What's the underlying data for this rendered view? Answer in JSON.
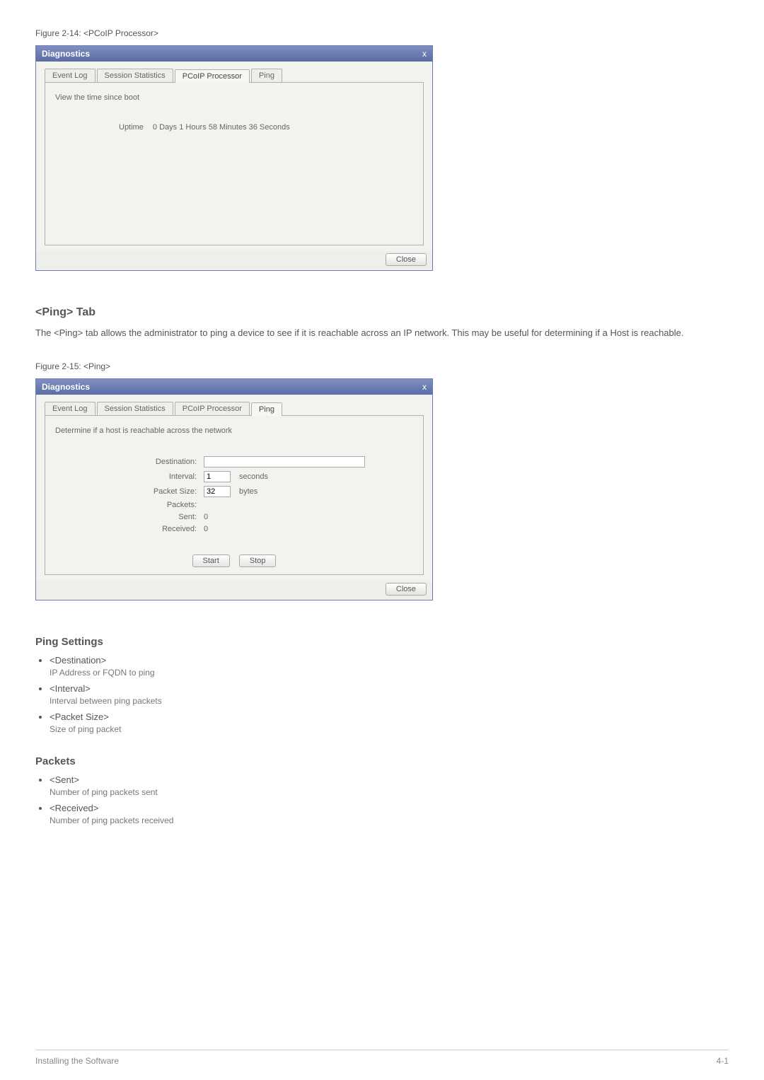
{
  "figure1": {
    "caption": "Figure 2-14: <PCoIP Processor>"
  },
  "dialog1": {
    "title": "Diagnostics",
    "close_label": "x",
    "tabs": {
      "event_log": "Event Log",
      "session_stats": "Session Statistics",
      "pcoip": "PCoIP Processor",
      "ping": "Ping"
    },
    "hint": "View the time since boot",
    "uptime_label": "Uptime",
    "uptime_value": "0 Days 1 Hours 58 Minutes 36 Seconds",
    "close_btn": "Close"
  },
  "ping_section": {
    "heading": "<Ping> Tab",
    "body": "The <Ping> tab allows the administrator to ping a device to see if it is reachable across an IP network. This may be useful for determining if a Host is reachable."
  },
  "figure2": {
    "caption": "Figure 2-15: <Ping>"
  },
  "dialog2": {
    "title": "Diagnostics",
    "close_label": "x",
    "tabs": {
      "event_log": "Event Log",
      "session_stats": "Session Statistics",
      "pcoip": "PCoIP Processor",
      "ping": "Ping"
    },
    "hint": "Determine if a host is reachable across the network",
    "rows": {
      "destination_label": "Destination:",
      "destination_value": "",
      "interval_label": "Interval:",
      "interval_value": "1",
      "interval_suffix": "seconds",
      "packetsize_label": "Packet Size:",
      "packetsize_value": "32",
      "packetsize_suffix": "bytes",
      "packets_label": "Packets:",
      "sent_label": "Sent:",
      "sent_value": "0",
      "received_label": "Received:",
      "received_value": "0"
    },
    "start_btn": "Start",
    "stop_btn": "Stop",
    "close_btn": "Close"
  },
  "ping_settings": {
    "heading": "Ping Settings",
    "items": [
      {
        "term": "<Destination>",
        "desc": "IP Address or FQDN to ping"
      },
      {
        "term": "<Interval>",
        "desc": "Interval between ping packets"
      },
      {
        "term": "<Packet Size>",
        "desc": "Size of ping packet"
      }
    ]
  },
  "packets": {
    "heading": "Packets",
    "items": [
      {
        "term": "<Sent>",
        "desc": "Number of ping packets sent"
      },
      {
        "term": "<Received>",
        "desc": "Number of ping packets received"
      }
    ]
  },
  "footer": {
    "left": "Installing the Software",
    "right": "4-1"
  }
}
